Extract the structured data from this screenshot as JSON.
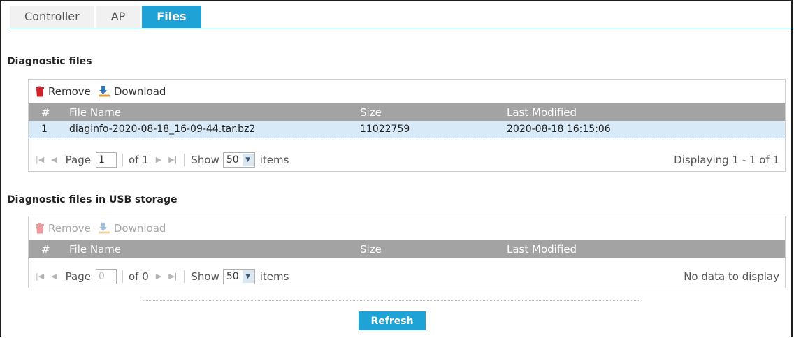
{
  "tabs": [
    {
      "label": "Controller",
      "active": false
    },
    {
      "label": "AP",
      "active": false
    },
    {
      "label": "Files",
      "active": true
    }
  ],
  "sections": {
    "diag": {
      "title": "Diagnostic files",
      "toolbar": {
        "remove": "Remove",
        "download": "Download"
      },
      "columns": {
        "num": "#",
        "name": "File Name",
        "size": "Size",
        "modified": "Last Modified"
      },
      "rows": [
        {
          "num": "1",
          "name": "diaginfo-2020-08-18_16-09-44.tar.bz2",
          "size": "11022759",
          "modified": "2020-08-18 16:15:06"
        }
      ],
      "pager": {
        "page_label": "Page",
        "page_value": "1",
        "of_label": "of 1",
        "show_label": "Show",
        "per_page": "50",
        "items_label": "items",
        "status": "Displaying 1 - 1 of 1"
      }
    },
    "usb": {
      "title": "Diagnostic files in USB storage",
      "toolbar": {
        "remove": "Remove",
        "download": "Download"
      },
      "columns": {
        "num": "#",
        "name": "File Name",
        "size": "Size",
        "modified": "Last Modified"
      },
      "rows": [],
      "pager": {
        "page_label": "Page",
        "page_value": "0",
        "of_label": "of 0",
        "show_label": "Show",
        "per_page": "50",
        "items_label": "items",
        "status": "No data to display"
      }
    }
  },
  "refresh_label": "Refresh",
  "colors": {
    "accent": "#1fa3d6",
    "header_gray": "#a3a3a3",
    "row_selected": "#d8eaf7",
    "trash_red": "#d8202a",
    "download_blue": "#2f74c0"
  },
  "icons": {
    "remove": "trash-icon",
    "download": "download-icon",
    "first": "first-page-icon",
    "prev": "prev-page-icon",
    "next": "next-page-icon",
    "last": "last-page-icon"
  }
}
